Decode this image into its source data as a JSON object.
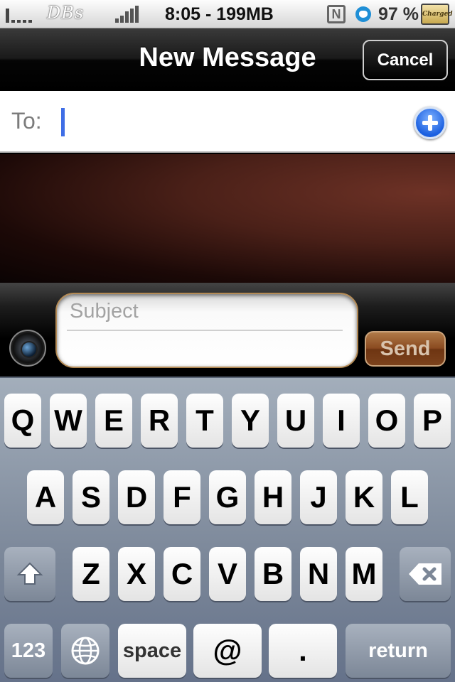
{
  "status_bar": {
    "brand": "DBs",
    "time": "8:05 - 199MB",
    "network_icon": "N",
    "battery_percent": "97 %",
    "battery_label": "Charged"
  },
  "nav": {
    "title": "New Message",
    "cancel": "Cancel"
  },
  "recipient": {
    "label": "To:"
  },
  "compose": {
    "subject_placeholder": "Subject",
    "send": "Send"
  },
  "keyboard": {
    "row1": [
      "Q",
      "W",
      "E",
      "R",
      "T",
      "Y",
      "U",
      "I",
      "O",
      "P"
    ],
    "row2": [
      "A",
      "S",
      "D",
      "F",
      "G",
      "H",
      "J",
      "K",
      "L"
    ],
    "row3": [
      "Z",
      "X",
      "C",
      "V",
      "B",
      "N",
      "M"
    ],
    "numbers": "123",
    "space": "space",
    "at": "@",
    "period": ".",
    "return": "return"
  }
}
